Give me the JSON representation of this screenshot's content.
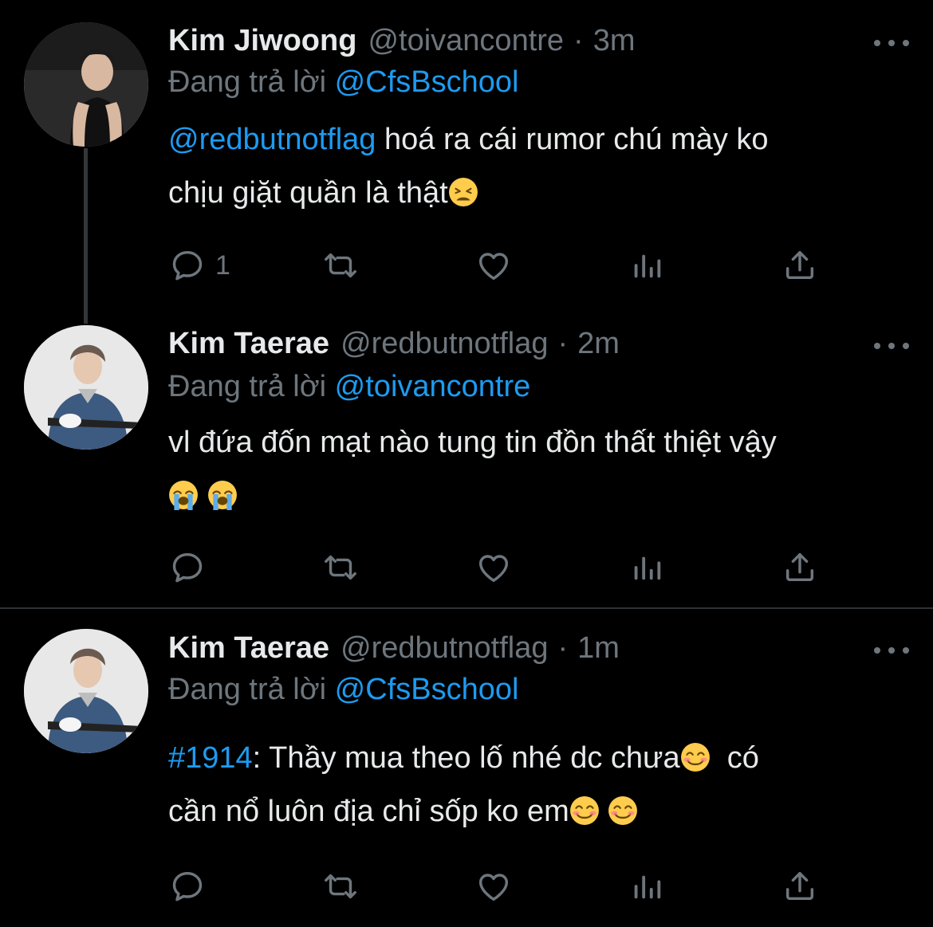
{
  "tweets": [
    {
      "name": "Kim Jiwoong",
      "handle": "@toivancontre",
      "separator": "·",
      "time": "3m",
      "reply_prefix": "Đang trả lời",
      "reply_to": "@CfsBschool",
      "mention": "@redbutnotflag",
      "line1_text": " hoá ra cái rumor chú mày ko",
      "line2_text": "chịu giặt quần là thật",
      "line2_emoji": "weary-face-emoji",
      "reply_count": "1"
    },
    {
      "name": "Kim Taerae",
      "handle": "@redbutnotflag",
      "separator": "·",
      "time": "2m",
      "reply_prefix": "Đang trả lời",
      "reply_to": "@toivancontre",
      "line1_text": "vl đứa đốn mạt nào tung tin đồn thất thiệt vậy",
      "line2_emojis": [
        "crying-face-emoji",
        "crying-face-emoji"
      ]
    },
    {
      "name": "Kim Taerae",
      "handle": "@redbutnotflag",
      "separator": "·",
      "time": "1m",
      "reply_prefix": "Đang trả lời",
      "reply_to": "@CfsBschool",
      "hashtag": "#1914",
      "line1_text": ": Thầy mua theo lố nhé dc chưa",
      "line1_tail": "có",
      "line2_text": "cần nổ luôn địa chỉ sốp ko em",
      "emojis": [
        "smiling-face-emoji",
        "smiling-face-emoji",
        "smiling-face-emoji"
      ]
    }
  ],
  "icons": {
    "reply": "reply-icon",
    "retweet": "retweet-icon",
    "like": "like-icon",
    "analytics": "analytics-icon",
    "share": "share-icon",
    "more": "more-icon"
  },
  "colors": {
    "background": "#000000",
    "text": "#e7e9ea",
    "secondary": "#6e767d",
    "link": "#1d9bf0",
    "divider": "#2f3336"
  }
}
